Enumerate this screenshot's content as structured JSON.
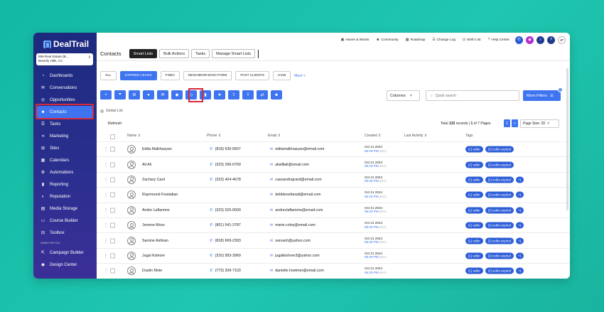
{
  "app": {
    "logo": "DealTrail"
  },
  "account": {
    "name": "MM Real Estate (B...",
    "location": "Beverly Hills, CA"
  },
  "sidebar": {
    "items": [
      {
        "label": "Dashboards",
        "icon": "dashboard-icon"
      },
      {
        "label": "Conversations",
        "icon": "chat-icon"
      },
      {
        "label": "Opportunities",
        "icon": "opportunity-icon"
      },
      {
        "label": "Contacts",
        "icon": "contacts-icon",
        "active": true
      },
      {
        "label": "Tasks",
        "icon": "tasks-icon"
      },
      {
        "label": "Marketing",
        "icon": "share-icon"
      },
      {
        "label": "Sites",
        "icon": "sites-icon"
      },
      {
        "label": "Calendars",
        "icon": "calendar-icon"
      },
      {
        "label": "Automations",
        "icon": "automation-icon"
      },
      {
        "label": "Reporting",
        "icon": "reporting-icon"
      },
      {
        "label": "Reputation",
        "icon": "reputation-icon"
      },
      {
        "label": "Media Storage",
        "icon": "media-icon"
      },
      {
        "label": "Course Builder",
        "icon": "course-icon"
      },
      {
        "label": "Toolbox",
        "icon": "toolbox-icon"
      }
    ],
    "section_label": "DONE FOR YOU",
    "extra_items": [
      {
        "label": "Campaign Builder",
        "icon": "campaign-icon"
      },
      {
        "label": "Design Center",
        "icon": "design-icon"
      }
    ]
  },
  "topbar": {
    "links": [
      "Haves & Wants",
      "Community",
      "Roadmap",
      "Change Log",
      "Wish List",
      "Help Center"
    ],
    "avatar": "JP"
  },
  "header": {
    "title": "Contacts",
    "tabs": [
      "Smart Lists",
      "Bulk Actions",
      "Tasks",
      "Manage Smart Lists"
    ]
  },
  "filters": {
    "chips": [
      "ALL",
      "EXPIRED LEADS",
      "FSBO",
      "NEIGHBORHOOD FARM",
      "PAST CLIENTS",
      "IHAB"
    ],
    "more": "More"
  },
  "toolbar": {
    "columns_label": "Columns",
    "search_placeholder": "Quick search",
    "more_filters_label": "More Filters",
    "more_filters_count": "1"
  },
  "list": {
    "global_label": "Global List",
    "refresh_label": "Refresh",
    "total_prefix": "Total",
    "total_count": "133",
    "total_suffix": "records |",
    "page_text": "1",
    "page_of": "of 7 Pages",
    "current_page": "1",
    "next_page": ">",
    "page_size": "Page Size: 20"
  },
  "table": {
    "columns": [
      "Name",
      "Phone",
      "Email",
      "Created",
      "Last Activity",
      "Tags"
    ],
    "rows": [
      {
        "name": "Edita Malkhasyan",
        "phone": "(818) 636-0507",
        "email": "editamalkhasyan@email.com",
        "date": "Oct 21 2024",
        "time": "06:29 PM",
        "tz": "(PDT)",
        "tags": [
          "(1) seller",
          "(2) seller-expired"
        ]
      },
      {
        "name": "Ali Ali",
        "phone": "(323) 296-0769",
        "email": "aliallliali@email.com",
        "date": "Oct 21 2024",
        "time": "06:29 PM",
        "tz": "(PDT)",
        "tags": [
          "(1) seller",
          "(2) seller-expired"
        ]
      },
      {
        "name": "Zachary Card",
        "phone": "(323) 424-4678",
        "email": "cassandrajcard@email.com",
        "date": "Oct 21 2024",
        "time": "06:29 PM",
        "tz": "(PDT)",
        "tags": [
          "(1) seller",
          "(2) seller-expired",
          "+1"
        ]
      },
      {
        "name": "Raymound Fouladian",
        "phone": "",
        "email": "debbiesefaradi@email.com",
        "date": "Oct 21 2024",
        "time": "06:29 PM",
        "tz": "(PDT)",
        "tags": [
          "(1) seller",
          "(2) seller-expired",
          "+1"
        ]
      },
      {
        "name": "Andre Laflamme",
        "phone": "(323) 525-0500",
        "email": "andrevlaflamme@email.com",
        "date": "Oct 21 2024",
        "time": "06:29 PM",
        "tz": "(PDT)",
        "tags": [
          "(1) seller",
          "(2) seller-expired",
          "+1"
        ]
      },
      {
        "name": "Jerome Moss",
        "phone": "(801) 541-3787",
        "email": "marie.coley@email.com",
        "date": "Oct 21 2024",
        "time": "06:29 PM",
        "tz": "(PDT)",
        "tags": [
          "(1) seller",
          "(2) seller-expired",
          "+1"
        ]
      },
      {
        "name": "Sarvine Ashkan",
        "phone": "(818) 669-2303",
        "email": "sarvash@yahoo.com",
        "date": "Oct 21 2024",
        "time": "06:29 PM",
        "tz": "(PDT)",
        "tags": [
          "(1) seller",
          "(2) seller-expired",
          "+1"
        ]
      },
      {
        "name": "Jugal Kishore",
        "phone": "(310) 993-3969",
        "email": "jugalkishore3@yahoo.com",
        "date": "Oct 21 2024",
        "time": "06:29 PM",
        "tz": "(PDT)",
        "tags": [
          "(1) seller",
          "(2) seller-expired",
          "+1"
        ]
      },
      {
        "name": "Dustin Mote",
        "phone": "(773) 209-7103",
        "email": "danielle.hoetmer@email.com",
        "date": "Oct 21 2024",
        "time": "06:29 PM",
        "tz": "(PDT)",
        "tags": [
          "(1) seller",
          "(2) seller-expired",
          "+1"
        ]
      }
    ]
  },
  "colors": {
    "accent": "#3e74f0",
    "sidebar": "#1c2a7e",
    "highlight": "#d8283b",
    "background": "#13b8a3"
  }
}
